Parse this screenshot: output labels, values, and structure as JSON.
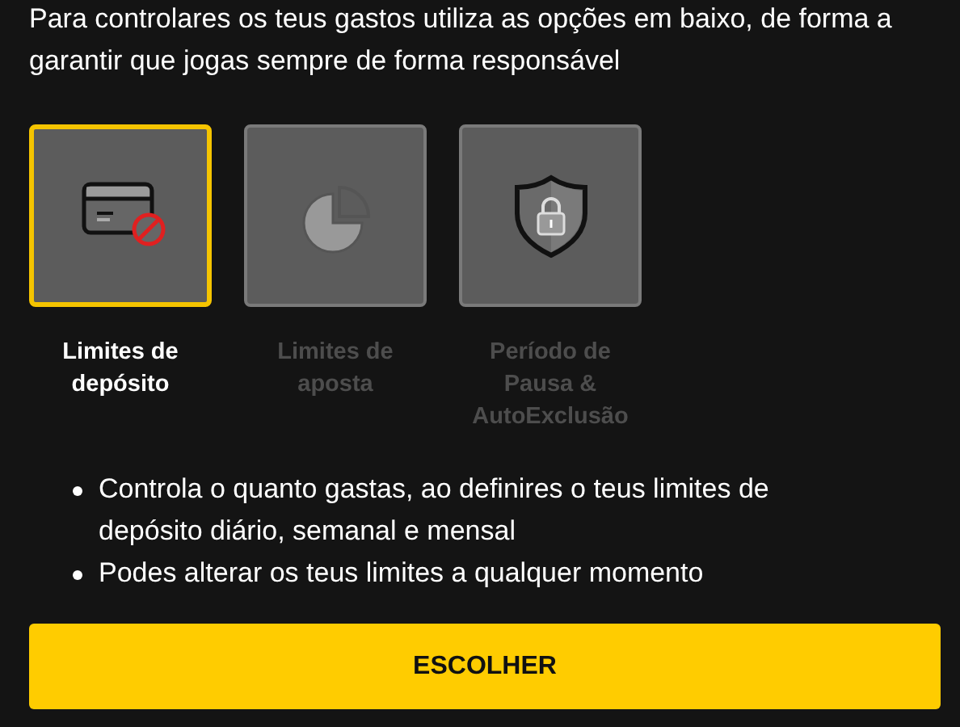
{
  "intro": "Para controlares os teus gastos utiliza as opções em baixo, de forma a garantir que jogas sempre de forma responsável",
  "options": [
    {
      "kind": "card",
      "label": "Limites de depósito",
      "selected": true
    },
    {
      "kind": "pie",
      "label": "Limites de aposta",
      "selected": false
    },
    {
      "kind": "shield",
      "label": "Período de Pausa & AutoExclusão",
      "selected": false
    }
  ],
  "bullets": [
    "Controla o quanto gastas, ao definires o teus limites de depósito diário, semanal e mensal",
    "Podes alterar os teus limites a qualquer momento"
  ],
  "button": "ESCOLHER"
}
